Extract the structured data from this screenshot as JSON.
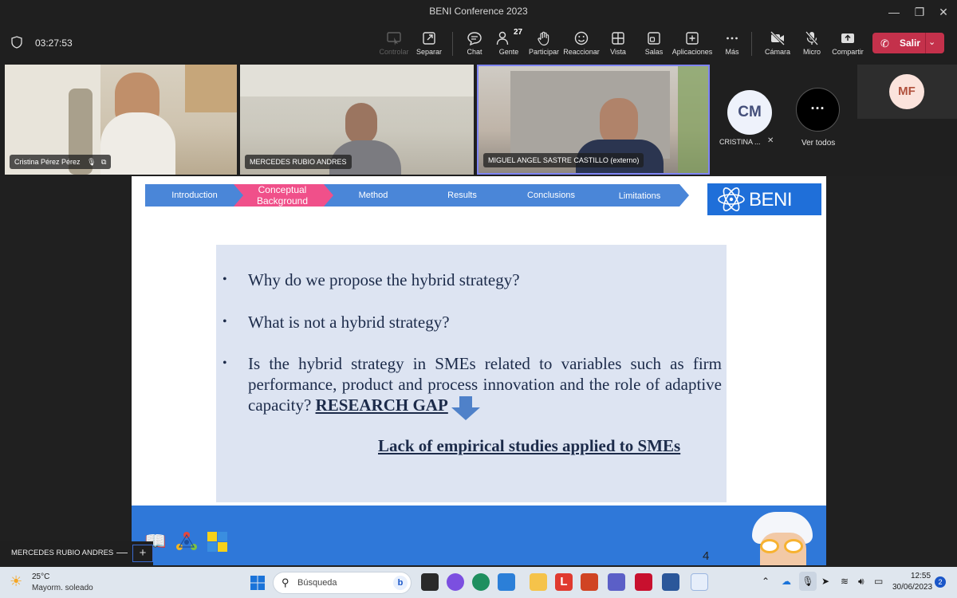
{
  "window": {
    "title": "BENI Conference 2023",
    "controls": [
      "—",
      "❐",
      "✕"
    ]
  },
  "toolbar": {
    "timer": "03:27:53",
    "buttons": [
      {
        "id": "controlar",
        "label": "Controlar",
        "icon": "control-icon",
        "disabled": true
      },
      {
        "id": "separar",
        "label": "Separar",
        "icon": "popout-icon"
      },
      {
        "id": "chat",
        "label": "Chat",
        "icon": "chat-icon"
      },
      {
        "id": "gente",
        "label": "Gente",
        "icon": "people-icon",
        "count": "27"
      },
      {
        "id": "participar",
        "label": "Participar",
        "icon": "raise-hand-icon"
      },
      {
        "id": "reaccionar",
        "label": "Reaccionar",
        "icon": "smile-icon"
      },
      {
        "id": "vista",
        "label": "Vista",
        "icon": "grid-icon"
      },
      {
        "id": "salas",
        "label": "Salas",
        "icon": "rooms-icon"
      },
      {
        "id": "aplicaciones",
        "label": "Aplicaciones",
        "icon": "add-icon"
      },
      {
        "id": "mas",
        "label": "Más",
        "icon": "more-icon"
      },
      {
        "id": "camara",
        "label": "Cámara",
        "icon": "camera-off-icon"
      },
      {
        "id": "micro",
        "label": "Micro",
        "icon": "mic-off-icon"
      },
      {
        "id": "compartir",
        "label": "Compartir",
        "icon": "share-icon"
      }
    ],
    "leave_label": "Salir"
  },
  "participants": {
    "tiles": [
      {
        "name": "Cristina Pérez Pérez"
      },
      {
        "name": "MERCEDES RUBIO ANDRES"
      },
      {
        "name": "MIGUEL ANGEL SASTRE CASTILLO (externo)"
      }
    ],
    "cm": {
      "initials": "CM",
      "name": "CRISTINA ..."
    },
    "ver_todos": "Ver todos",
    "mf": {
      "initials": "MF"
    }
  },
  "slide": {
    "nav": [
      "Introduction",
      "Conceptual Background",
      "Method",
      "Results",
      "Conclusions",
      "Limitations"
    ],
    "active_nav": 1,
    "logo_text": "BENI",
    "bullets": [
      "Why do we propose the hybrid strategy?",
      "What is not a hybrid strategy?",
      "Is the hybrid strategy in SMEs related to variables such as firm performance, product and process innovation and the role of adaptive capacity?"
    ],
    "research_gap": "RESEARCH GAP",
    "lack": "Lack of empirical studies applied to SMEs",
    "page": "4"
  },
  "self_view": {
    "name": "MERCEDES RUBIO ANDRES"
  },
  "taskbar": {
    "weather_temp": "25°C",
    "weather_desc": "Mayorm. soleado",
    "search_placeholder": "Búsqueda",
    "time": "12:55",
    "date": "30/06/2023",
    "notifications": "2"
  },
  "colors": {
    "leave": "#c4314b",
    "nav": "#4a86d8",
    "nav_active": "#f0508a",
    "logo_bg": "#1f6fd9",
    "content_bg": "#dde4f2",
    "band": "#2f78d9",
    "text_navy": "#1c2b4a"
  }
}
